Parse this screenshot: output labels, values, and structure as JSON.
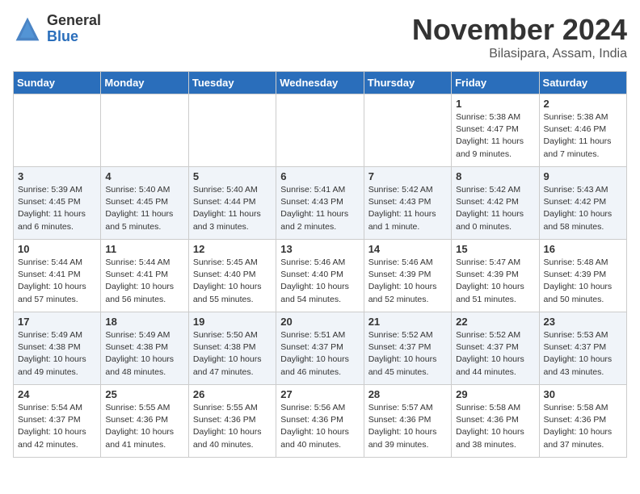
{
  "header": {
    "logo_general": "General",
    "logo_blue": "Blue",
    "month": "November 2024",
    "location": "Bilasipara, Assam, India"
  },
  "days_of_week": [
    "Sunday",
    "Monday",
    "Tuesday",
    "Wednesday",
    "Thursday",
    "Friday",
    "Saturday"
  ],
  "weeks": [
    [
      {
        "day": "",
        "info": ""
      },
      {
        "day": "",
        "info": ""
      },
      {
        "day": "",
        "info": ""
      },
      {
        "day": "",
        "info": ""
      },
      {
        "day": "",
        "info": ""
      },
      {
        "day": "1",
        "info": "Sunrise: 5:38 AM\nSunset: 4:47 PM\nDaylight: 11 hours\nand 9 minutes."
      },
      {
        "day": "2",
        "info": "Sunrise: 5:38 AM\nSunset: 4:46 PM\nDaylight: 11 hours\nand 7 minutes."
      }
    ],
    [
      {
        "day": "3",
        "info": "Sunrise: 5:39 AM\nSunset: 4:45 PM\nDaylight: 11 hours\nand 6 minutes."
      },
      {
        "day": "4",
        "info": "Sunrise: 5:40 AM\nSunset: 4:45 PM\nDaylight: 11 hours\nand 5 minutes."
      },
      {
        "day": "5",
        "info": "Sunrise: 5:40 AM\nSunset: 4:44 PM\nDaylight: 11 hours\nand 3 minutes."
      },
      {
        "day": "6",
        "info": "Sunrise: 5:41 AM\nSunset: 4:43 PM\nDaylight: 11 hours\nand 2 minutes."
      },
      {
        "day": "7",
        "info": "Sunrise: 5:42 AM\nSunset: 4:43 PM\nDaylight: 11 hours\nand 1 minute."
      },
      {
        "day": "8",
        "info": "Sunrise: 5:42 AM\nSunset: 4:42 PM\nDaylight: 11 hours\nand 0 minutes."
      },
      {
        "day": "9",
        "info": "Sunrise: 5:43 AM\nSunset: 4:42 PM\nDaylight: 10 hours\nand 58 minutes."
      }
    ],
    [
      {
        "day": "10",
        "info": "Sunrise: 5:44 AM\nSunset: 4:41 PM\nDaylight: 10 hours\nand 57 minutes."
      },
      {
        "day": "11",
        "info": "Sunrise: 5:44 AM\nSunset: 4:41 PM\nDaylight: 10 hours\nand 56 minutes."
      },
      {
        "day": "12",
        "info": "Sunrise: 5:45 AM\nSunset: 4:40 PM\nDaylight: 10 hours\nand 55 minutes."
      },
      {
        "day": "13",
        "info": "Sunrise: 5:46 AM\nSunset: 4:40 PM\nDaylight: 10 hours\nand 54 minutes."
      },
      {
        "day": "14",
        "info": "Sunrise: 5:46 AM\nSunset: 4:39 PM\nDaylight: 10 hours\nand 52 minutes."
      },
      {
        "day": "15",
        "info": "Sunrise: 5:47 AM\nSunset: 4:39 PM\nDaylight: 10 hours\nand 51 minutes."
      },
      {
        "day": "16",
        "info": "Sunrise: 5:48 AM\nSunset: 4:39 PM\nDaylight: 10 hours\nand 50 minutes."
      }
    ],
    [
      {
        "day": "17",
        "info": "Sunrise: 5:49 AM\nSunset: 4:38 PM\nDaylight: 10 hours\nand 49 minutes."
      },
      {
        "day": "18",
        "info": "Sunrise: 5:49 AM\nSunset: 4:38 PM\nDaylight: 10 hours\nand 48 minutes."
      },
      {
        "day": "19",
        "info": "Sunrise: 5:50 AM\nSunset: 4:38 PM\nDaylight: 10 hours\nand 47 minutes."
      },
      {
        "day": "20",
        "info": "Sunrise: 5:51 AM\nSunset: 4:37 PM\nDaylight: 10 hours\nand 46 minutes."
      },
      {
        "day": "21",
        "info": "Sunrise: 5:52 AM\nSunset: 4:37 PM\nDaylight: 10 hours\nand 45 minutes."
      },
      {
        "day": "22",
        "info": "Sunrise: 5:52 AM\nSunset: 4:37 PM\nDaylight: 10 hours\nand 44 minutes."
      },
      {
        "day": "23",
        "info": "Sunrise: 5:53 AM\nSunset: 4:37 PM\nDaylight: 10 hours\nand 43 minutes."
      }
    ],
    [
      {
        "day": "24",
        "info": "Sunrise: 5:54 AM\nSunset: 4:37 PM\nDaylight: 10 hours\nand 42 minutes."
      },
      {
        "day": "25",
        "info": "Sunrise: 5:55 AM\nSunset: 4:36 PM\nDaylight: 10 hours\nand 41 minutes."
      },
      {
        "day": "26",
        "info": "Sunrise: 5:55 AM\nSunset: 4:36 PM\nDaylight: 10 hours\nand 40 minutes."
      },
      {
        "day": "27",
        "info": "Sunrise: 5:56 AM\nSunset: 4:36 PM\nDaylight: 10 hours\nand 40 minutes."
      },
      {
        "day": "28",
        "info": "Sunrise: 5:57 AM\nSunset: 4:36 PM\nDaylight: 10 hours\nand 39 minutes."
      },
      {
        "day": "29",
        "info": "Sunrise: 5:58 AM\nSunset: 4:36 PM\nDaylight: 10 hours\nand 38 minutes."
      },
      {
        "day": "30",
        "info": "Sunrise: 5:58 AM\nSunset: 4:36 PM\nDaylight: 10 hours\nand 37 minutes."
      }
    ]
  ]
}
